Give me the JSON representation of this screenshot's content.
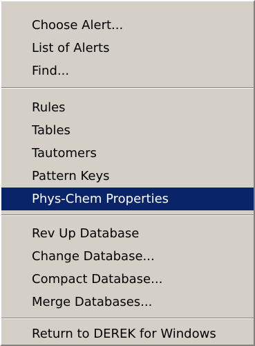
{
  "menu": {
    "items": [
      "Choose Alert...",
      "List of Alerts",
      "Find...",
      "Rules",
      "Tables",
      "Tautomers",
      "Pattern Keys",
      "Phys-Chem Properties",
      "Rev Up Database",
      "Change Database...",
      "Compact Database...",
      "Merge Databases...",
      "Return to DEREK for Windows"
    ],
    "selected_item": "Phys-Chem Properties"
  },
  "colors": {
    "menu_background": "#d4d0c8",
    "highlight_background": "#0a246a",
    "highlight_text": "#ffffff"
  }
}
